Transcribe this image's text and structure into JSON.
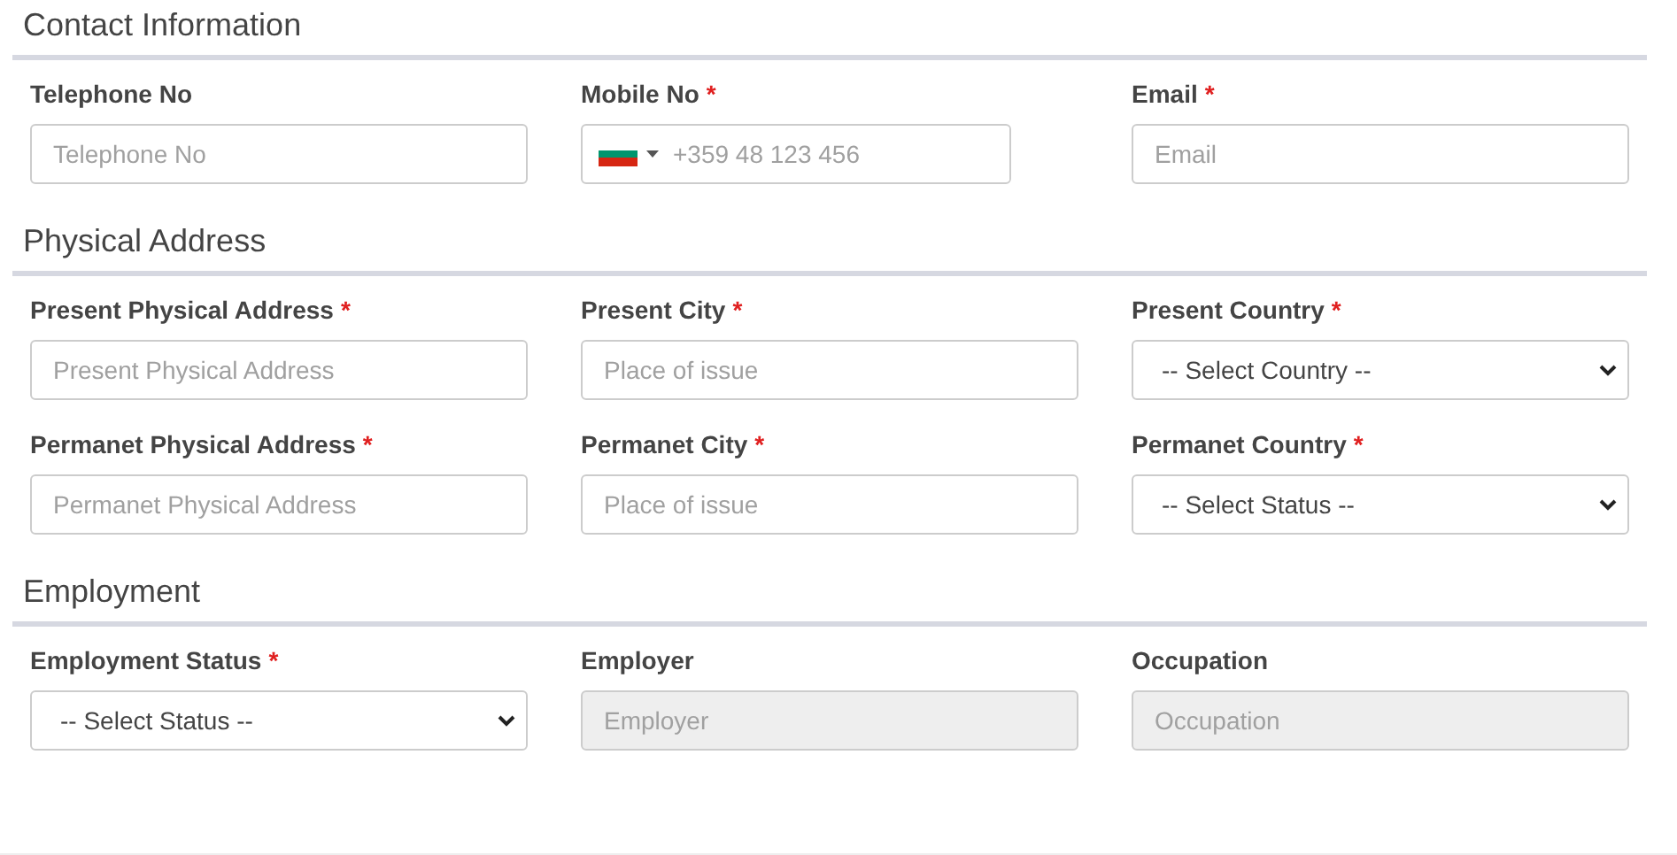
{
  "sections": [
    {
      "title": "Contact Information",
      "rows": [
        [
          {
            "kind": "text",
            "label": "Telephone No",
            "required": false,
            "placeholder": "Telephone No",
            "disabled": false
          },
          {
            "kind": "phone",
            "label": "Mobile No",
            "required": true,
            "placeholder": "+359 48 123 456",
            "disabled": false
          },
          {
            "kind": "text",
            "label": "Email",
            "required": true,
            "placeholder": "Email",
            "disabled": false
          }
        ]
      ]
    },
    {
      "title": "Physical Address",
      "rows": [
        [
          {
            "kind": "text",
            "label": "Present Physical Address",
            "required": true,
            "placeholder": "Present Physical Address",
            "disabled": false
          },
          {
            "kind": "text",
            "label": "Present City",
            "required": true,
            "placeholder": "Place of issue",
            "disabled": false
          },
          {
            "kind": "select",
            "label": "Present Country",
            "required": true,
            "value": "-- Select Country --",
            "disabled": false
          }
        ],
        [
          {
            "kind": "text",
            "label": "Permanet Physical Address",
            "required": true,
            "placeholder": "Permanet Physical Address",
            "disabled": false
          },
          {
            "kind": "text",
            "label": "Permanet City",
            "required": true,
            "placeholder": "Place of issue",
            "disabled": false
          },
          {
            "kind": "select",
            "label": "Permanet Country",
            "required": true,
            "value": "-- Select Status --",
            "disabled": false
          }
        ]
      ]
    },
    {
      "title": "Employment",
      "rows": [
        [
          {
            "kind": "select",
            "label": "Employment Status",
            "required": true,
            "value": "-- Select Status --",
            "disabled": false
          },
          {
            "kind": "text",
            "label": "Employer",
            "required": false,
            "placeholder": "Employer",
            "disabled": true
          },
          {
            "kind": "text",
            "label": "Occupation",
            "required": false,
            "placeholder": "Occupation",
            "disabled": true
          }
        ]
      ]
    }
  ],
  "required_mark": "*"
}
